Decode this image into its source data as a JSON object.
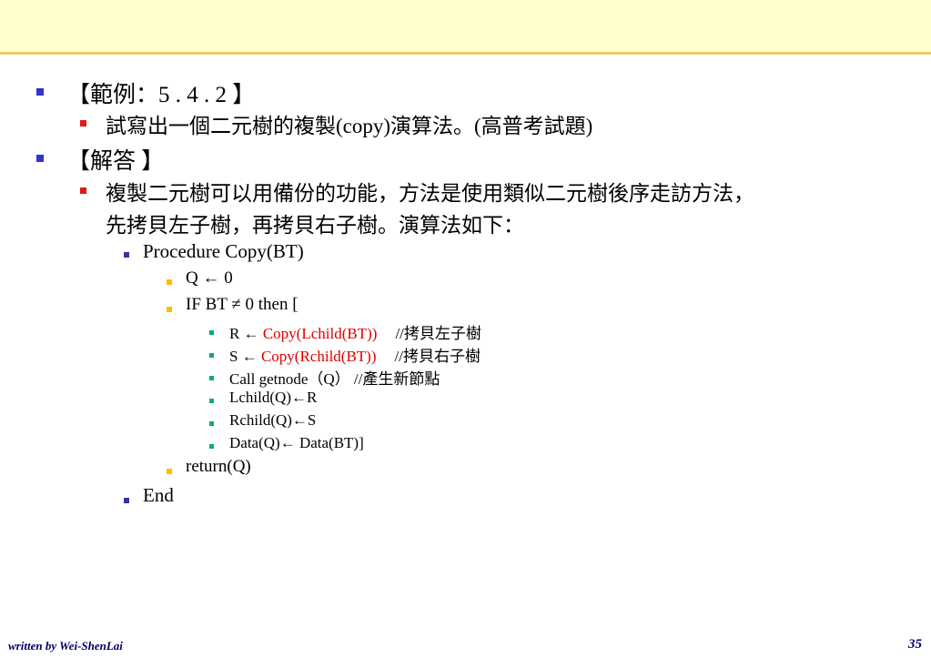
{
  "slide": {
    "example_heading": "【範例：5 . 4 . 2 】",
    "question": "試寫出一個二元樹的複製(copy)演算法。(高普考試題)",
    "answer_heading": "【解答 】",
    "answer_line1": "複製二元樹可以用備份的功能，方法是使用類似二元樹後序走訪方法，",
    "answer_line2": "先拷貝左子樹，再拷貝右子樹。演算法如下：",
    "procedure": "Procedure Copy(BT)",
    "q_assign": "Q ← 0",
    "if_line": "IF BT ≠ 0 then [",
    "r_prefix": "R ← ",
    "r_call": "Copy(Lchild(BT))",
    "r_comment": "//拷貝左子樹",
    "s_prefix": "S ← ",
    "s_call": "Copy(Rchild(BT))",
    "s_comment": "//拷貝右子樹",
    "getnode": "Call getnode（Q） //產生新節點",
    "lchild": "Lchild(Q)←R",
    "rchild": "Rchild(Q)←S",
    "data": "Data(Q)← Data(BT)]",
    "return_line": "return(Q)",
    "end_line": "End"
  },
  "footer": {
    "author": "written by Wei-ShenLai",
    "page_number": "35"
  },
  "colors": {
    "header_band": "#ffffcc",
    "header_rule": "#f3c56a",
    "highlight_red": "#e00000",
    "footer_text": "#000066"
  }
}
